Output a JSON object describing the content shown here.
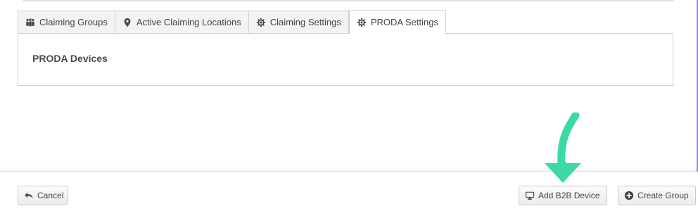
{
  "tabs": [
    {
      "label": "Claiming Groups",
      "icon": "group-icon"
    },
    {
      "label": "Active Claiming Locations",
      "icon": "map-pin-icon"
    },
    {
      "label": "Claiming Settings",
      "icon": "gear-icon"
    },
    {
      "label": "PRODA Settings",
      "icon": "gear-icon",
      "active": true
    }
  ],
  "panel": {
    "title": "PRODA Devices"
  },
  "footer": {
    "cancel_label": "Cancel",
    "add_b2b_label": "Add B2B Device",
    "create_group_label": "Create Group"
  },
  "colors": {
    "annotation_arrow": "#3dd9a4",
    "accent_edge": "#7a64c8"
  }
}
